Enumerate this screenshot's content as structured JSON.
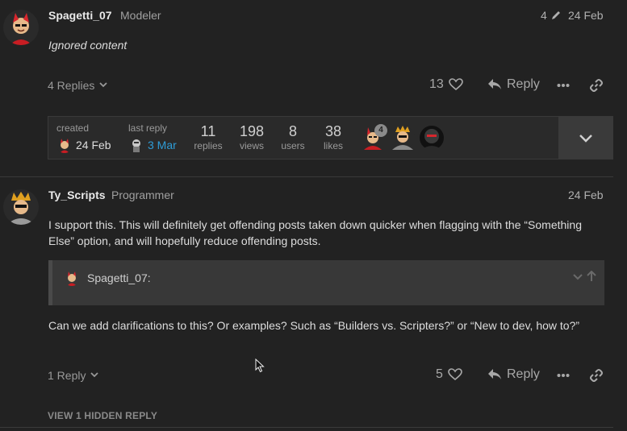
{
  "post1": {
    "username": "Spagetti_07",
    "user_title": "Modeler",
    "edit_count": "4",
    "date": "24 Feb",
    "content": "Ignored content",
    "replies_toggle": "4 Replies",
    "like_count": "13",
    "reply_label": "Reply"
  },
  "topic_map": {
    "created_label": "created",
    "created_date": "24 Feb",
    "last_reply_label": "last reply",
    "last_reply_date": "3 Mar",
    "stats": [
      {
        "num": "11",
        "label": "replies"
      },
      {
        "num": "198",
        "label": "views"
      },
      {
        "num": "8",
        "label": "users"
      },
      {
        "num": "38",
        "label": "likes"
      }
    ],
    "participant_badge": "4"
  },
  "post2": {
    "username": "Ty_Scripts",
    "user_title": "Programmer",
    "date": "24 Feb",
    "paragraph1": "I support this. This will definitely get offending posts taken down quicker when flagging with the “Something Else” option, and will hopefully reduce offending posts.",
    "quote_author": "Spagetti_07:",
    "paragraph2": "Can we add clarifications to this? Or examples? Such as “Builders vs. Scripters?” or “New to dev, how to?”",
    "replies_toggle": "1 Reply",
    "like_count": "5",
    "reply_label": "Reply"
  },
  "hidden_replies": "VIEW 1 HIDDEN REPLY",
  "colors": {
    "background": "#222222",
    "link": "#2e9cd6",
    "accent_red": "#d8262d"
  }
}
